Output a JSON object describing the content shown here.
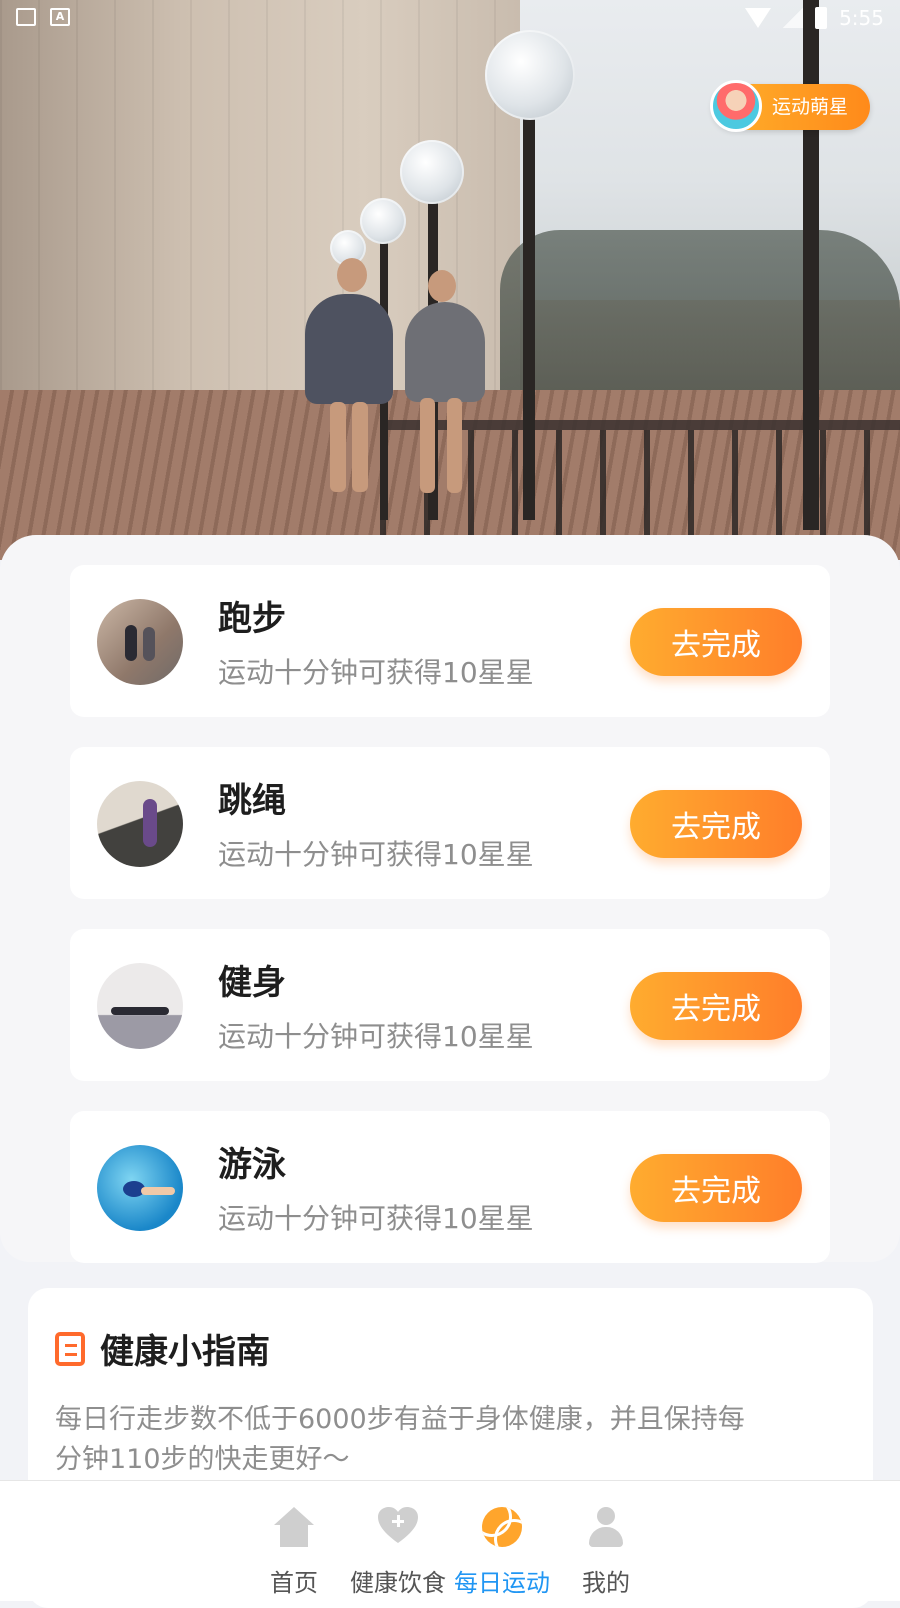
{
  "status_bar": {
    "time": "5:55",
    "left_icons": [
      "image-icon",
      "a-icon"
    ],
    "right_icons": [
      "wifi-icon",
      "signal-icon",
      "battery-icon"
    ]
  },
  "hero": {
    "badge_label": "运动萌星"
  },
  "tasks": [
    {
      "title": "跑步",
      "desc": "运动十分钟可获得10星星",
      "button": "去完成",
      "icon": "running-photo"
    },
    {
      "title": "跳绳",
      "desc": "运动十分钟可获得10星星",
      "button": "去完成",
      "icon": "jump-rope-photo"
    },
    {
      "title": "健身",
      "desc": "运动十分钟可获得10星星",
      "button": "去完成",
      "icon": "fitness-photo"
    },
    {
      "title": "游泳",
      "desc": "运动十分钟可获得10星星",
      "button": "去完成",
      "icon": "swimming-photo"
    }
  ],
  "guide": {
    "title": "健康小指南",
    "text": "每日行走步数不低于6000步有益于身体健康，并且保持每分钟110步的快走更好～"
  },
  "nav": {
    "items": [
      {
        "label": "首页",
        "icon": "home-icon"
      },
      {
        "label": "健康饮食",
        "icon": "heart-plus-icon"
      },
      {
        "label": "每日运动",
        "icon": "ball-icon"
      },
      {
        "label": "我的",
        "icon": "user-icon"
      }
    ],
    "active_index": 2,
    "active_color": "#2196f3"
  },
  "colors": {
    "accent": "#ff8a1a",
    "button_start": "#ffac2f",
    "button_end": "#ff7e2a",
    "guide_icon": "#ff6a2c"
  }
}
